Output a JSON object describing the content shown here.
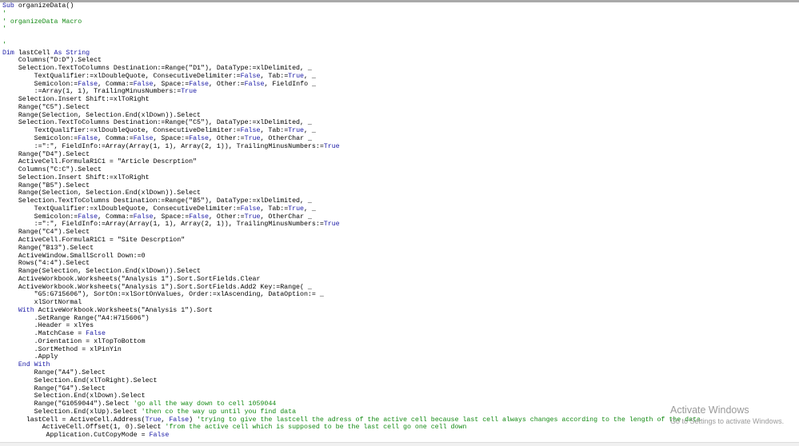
{
  "code": {
    "lines": [
      [
        {
          "t": "k",
          "v": "Sub"
        },
        {
          "t": "n",
          "v": " organizeData()"
        }
      ],
      [
        {
          "t": "c",
          "v": "'"
        }
      ],
      [
        {
          "t": "c",
          "v": "' organizeData Macro"
        }
      ],
      [
        {
          "t": "c",
          "v": "'"
        }
      ],
      [],
      [
        {
          "t": "c",
          "v": "'"
        }
      ],
      [
        {
          "t": "k",
          "v": "Dim"
        },
        {
          "t": "n",
          "v": " lastCell "
        },
        {
          "t": "k",
          "v": "As String"
        }
      ],
      [
        {
          "t": "n",
          "v": "    Columns(\"D:D\").Select"
        }
      ],
      [
        {
          "t": "n",
          "v": "    Selection.TextToColumns Destination:=Range(\"D1\"), DataType:=xlDelimited, _"
        }
      ],
      [
        {
          "t": "n",
          "v": "        TextQualifier:=xlDoubleQuote, ConsecutiveDelimiter:="
        },
        {
          "t": "k",
          "v": "False"
        },
        {
          "t": "n",
          "v": ", Tab:="
        },
        {
          "t": "k",
          "v": "True"
        },
        {
          "t": "n",
          "v": ", _"
        }
      ],
      [
        {
          "t": "n",
          "v": "        Semicolon:="
        },
        {
          "t": "k",
          "v": "False"
        },
        {
          "t": "n",
          "v": ", Comma:="
        },
        {
          "t": "k",
          "v": "False"
        },
        {
          "t": "n",
          "v": ", Space:="
        },
        {
          "t": "k",
          "v": "False"
        },
        {
          "t": "n",
          "v": ", Other:="
        },
        {
          "t": "k",
          "v": "False"
        },
        {
          "t": "n",
          "v": ", FieldInfo _"
        }
      ],
      [
        {
          "t": "n",
          "v": "        :=Array(1, 1), TrailingMinusNumbers:="
        },
        {
          "t": "k",
          "v": "True"
        }
      ],
      [
        {
          "t": "n",
          "v": "    Selection.Insert Shift:=xlToRight"
        }
      ],
      [
        {
          "t": "n",
          "v": "    Range(\"C5\").Select"
        }
      ],
      [
        {
          "t": "n",
          "v": "    Range(Selection, Selection.End(xlDown)).Select"
        }
      ],
      [
        {
          "t": "n",
          "v": "    Selection.TextToColumns Destination:=Range(\"C5\"), DataType:=xlDelimited, _"
        }
      ],
      [
        {
          "t": "n",
          "v": "        TextQualifier:=xlDoubleQuote, ConsecutiveDelimiter:="
        },
        {
          "t": "k",
          "v": "False"
        },
        {
          "t": "n",
          "v": ", Tab:="
        },
        {
          "t": "k",
          "v": "True"
        },
        {
          "t": "n",
          "v": ", _"
        }
      ],
      [
        {
          "t": "n",
          "v": "        Semicolon:="
        },
        {
          "t": "k",
          "v": "False"
        },
        {
          "t": "n",
          "v": ", Comma:="
        },
        {
          "t": "k",
          "v": "False"
        },
        {
          "t": "n",
          "v": ", Space:="
        },
        {
          "t": "k",
          "v": "False"
        },
        {
          "t": "n",
          "v": ", Other:="
        },
        {
          "t": "k",
          "v": "True"
        },
        {
          "t": "n",
          "v": ", OtherChar _"
        }
      ],
      [
        {
          "t": "n",
          "v": "        :=\":\", FieldInfo:=Array(Array(1, 1), Array(2, 1)), TrailingMinusNumbers:="
        },
        {
          "t": "k",
          "v": "True"
        }
      ],
      [
        {
          "t": "n",
          "v": "    Range(\"D4\").Select"
        }
      ],
      [
        {
          "t": "n",
          "v": "    ActiveCell.FormulaR1C1 = \"Article Descrption\""
        }
      ],
      [
        {
          "t": "n",
          "v": "    Columns(\"C:C\").Select"
        }
      ],
      [
        {
          "t": "n",
          "v": "    Selection.Insert Shift:=xlToRight"
        }
      ],
      [
        {
          "t": "n",
          "v": "    Range(\"B5\").Select"
        }
      ],
      [
        {
          "t": "n",
          "v": "    Range(Selection, Selection.End(xlDown)).Select"
        }
      ],
      [
        {
          "t": "n",
          "v": "    Selection.TextToColumns Destination:=Range(\"B5\"), DataType:=xlDelimited, _"
        }
      ],
      [
        {
          "t": "n",
          "v": "        TextQualifier:=xlDoubleQuote, ConsecutiveDelimiter:="
        },
        {
          "t": "k",
          "v": "False"
        },
        {
          "t": "n",
          "v": ", Tab:="
        },
        {
          "t": "k",
          "v": "True"
        },
        {
          "t": "n",
          "v": ", _"
        }
      ],
      [
        {
          "t": "n",
          "v": "        Semicolon:="
        },
        {
          "t": "k",
          "v": "False"
        },
        {
          "t": "n",
          "v": ", Comma:="
        },
        {
          "t": "k",
          "v": "False"
        },
        {
          "t": "n",
          "v": ", Space:="
        },
        {
          "t": "k",
          "v": "False"
        },
        {
          "t": "n",
          "v": ", Other:="
        },
        {
          "t": "k",
          "v": "True"
        },
        {
          "t": "n",
          "v": ", OtherChar _"
        }
      ],
      [
        {
          "t": "n",
          "v": "        :=\":\", FieldInfo:=Array(Array(1, 1), Array(2, 1)), TrailingMinusNumbers:="
        },
        {
          "t": "k",
          "v": "True"
        }
      ],
      [
        {
          "t": "n",
          "v": "    Range(\"C4\").Select"
        }
      ],
      [
        {
          "t": "n",
          "v": "    ActiveCell.FormulaR1C1 = \"Site Descrption\""
        }
      ],
      [
        {
          "t": "n",
          "v": "    Range(\"B13\").Select"
        }
      ],
      [
        {
          "t": "n",
          "v": "    ActiveWindow.SmallScroll Down:=0"
        }
      ],
      [
        {
          "t": "n",
          "v": "    Rows(\"4:4\").Select"
        }
      ],
      [
        {
          "t": "n",
          "v": "    Range(Selection, Selection.End(xlDown)).Select"
        }
      ],
      [
        {
          "t": "n",
          "v": "    ActiveWorkbook.Worksheets(\"Analysis 1\").Sort.SortFields.Clear"
        }
      ],
      [
        {
          "t": "n",
          "v": "    ActiveWorkbook.Worksheets(\"Analysis 1\").Sort.SortFields.Add2 Key:=Range( _"
        }
      ],
      [
        {
          "t": "n",
          "v": "        \"G5:G715606\"), SortOn:=xlSortOnValues, Order:=xlAscending, DataOption:= _"
        }
      ],
      [
        {
          "t": "n",
          "v": "        xlSortNormal"
        }
      ],
      [
        {
          "t": "k",
          "v": "    With"
        },
        {
          "t": "n",
          "v": " ActiveWorkbook.Worksheets(\"Analysis 1\").Sort"
        }
      ],
      [
        {
          "t": "n",
          "v": "        .SetRange Range(\"A4:H715606\")"
        }
      ],
      [
        {
          "t": "n",
          "v": "        .Header = xlYes"
        }
      ],
      [
        {
          "t": "n",
          "v": "        .MatchCase = "
        },
        {
          "t": "k",
          "v": "False"
        }
      ],
      [
        {
          "t": "n",
          "v": "        .Orientation = xlTopToBottom"
        }
      ],
      [
        {
          "t": "n",
          "v": "        .SortMethod = xlPinYin"
        }
      ],
      [
        {
          "t": "n",
          "v": "        .Apply"
        }
      ],
      [
        {
          "t": "k",
          "v": "    End With"
        }
      ],
      [
        {
          "t": "n",
          "v": "        Range(\"A4\").Select"
        }
      ],
      [
        {
          "t": "n",
          "v": "        Selection.End(xlToRight).Select"
        }
      ],
      [
        {
          "t": "n",
          "v": "        Range(\"G4\").Select"
        }
      ],
      [
        {
          "t": "n",
          "v": "        Selection.End(xlDown).Select"
        }
      ],
      [
        {
          "t": "n",
          "v": "        Range(\"G1059044\").Select "
        },
        {
          "t": "c",
          "v": "'go all the way down to cell 1059044"
        }
      ],
      [
        {
          "t": "n",
          "v": "        Selection.End(xlUp).Select "
        },
        {
          "t": "c",
          "v": "'then co the way up until you find data"
        }
      ],
      [
        {
          "t": "n",
          "v": "      lastCell = ActiveCell.Address("
        },
        {
          "t": "k",
          "v": "True"
        },
        {
          "t": "n",
          "v": ", "
        },
        {
          "t": "k",
          "v": "False"
        },
        {
          "t": "n",
          "v": ") "
        },
        {
          "t": "c",
          "v": "'trying to give the lastcell the adress of the active cell because last cell always changes according to the length of the data"
        }
      ],
      [
        {
          "t": "n",
          "v": "          ActiveCell.Offset(1, 0).Select "
        },
        {
          "t": "c",
          "v": "'from the active cell which is supposed to be the last cell go one cell down"
        }
      ],
      [
        {
          "t": "n",
          "v": "           Application.CutCopyMode = "
        },
        {
          "t": "k",
          "v": "False"
        }
      ]
    ]
  },
  "watermark": {
    "title": "Activate Windows",
    "subtitle": "Go to Settings to activate Windows."
  }
}
